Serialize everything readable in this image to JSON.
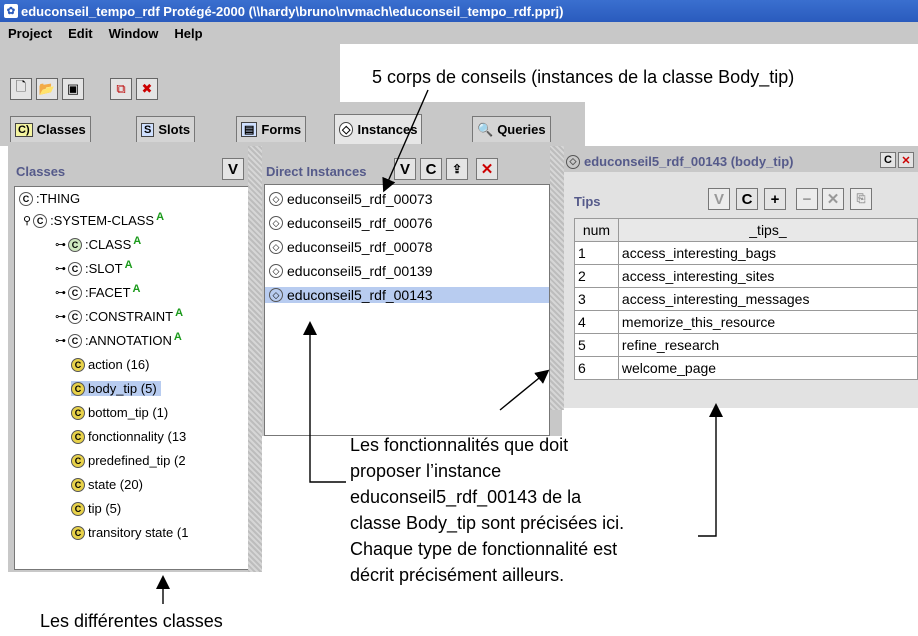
{
  "window": {
    "title": "educonseil_tempo_rdf  Protégé-2000   (\\\\hardy\\bruno\\nvmach\\educonseil_tempo_rdf.pprj)"
  },
  "menu": [
    "Project",
    "Edit",
    "Window",
    "Help"
  ],
  "toolbar_icons": [
    "new-project-icon",
    "open-project-icon",
    "save-project-icon",
    "cascade-icon",
    "close-icon"
  ],
  "tabs": [
    {
      "label": "Classes",
      "icon": "C"
    },
    {
      "label": "Slots",
      "icon": "S"
    },
    {
      "label": "Forms",
      "icon": "F"
    },
    {
      "label": "Instances",
      "icon": "I"
    },
    {
      "label": "Queries",
      "icon": "Q"
    }
  ],
  "classes_panel": {
    "header": "Classes",
    "v_button": "V",
    "tree": [
      {
        "label": ":THING",
        "marker": ""
      },
      {
        "label": ":SYSTEM-CLASS",
        "marker": "A"
      },
      {
        "label": ":CLASS",
        "marker": "A"
      },
      {
        "label": ":SLOT",
        "marker": "A"
      },
      {
        "label": ":FACET",
        "marker": "A"
      },
      {
        "label": ":CONSTRAINT",
        "marker": "A"
      },
      {
        "label": ":ANNOTATION",
        "marker": "A"
      },
      {
        "label": "action  (16)",
        "marker": ""
      },
      {
        "label": "body_tip  (5)",
        "marker": "",
        "selected": true
      },
      {
        "label": "bottom_tip  (1)",
        "marker": ""
      },
      {
        "label": "fonctionnality  (13",
        "marker": ""
      },
      {
        "label": "predefined_tip  (2",
        "marker": ""
      },
      {
        "label": "state  (20)",
        "marker": ""
      },
      {
        "label": "tip  (5)",
        "marker": ""
      },
      {
        "label": "transitory state  (1",
        "marker": ""
      }
    ]
  },
  "instances_panel": {
    "header": "Direct Instances",
    "buttons": [
      "V",
      "C"
    ],
    "items": [
      "educonseil5_rdf_00073",
      "educonseil5_rdf_00076",
      "educonseil5_rdf_00078",
      "educonseil5_rdf_00139",
      "educonseil5_rdf_00143"
    ],
    "selected_index": 4
  },
  "form_panel": {
    "header": "educonseil5_rdf_00143  (body_tip)",
    "header_button": "C",
    "tips_label": "Tips",
    "tips_buttons": [
      "V",
      "C",
      "+",
      "−"
    ],
    "columns": [
      "num",
      "_tips_"
    ],
    "rows": [
      [
        "1",
        "access_interesting_bags"
      ],
      [
        "2",
        "access_interesting_sites"
      ],
      [
        "3",
        "access_interesting_messages"
      ],
      [
        "4",
        "memorize_this_resource"
      ],
      [
        "5",
        "refine_research"
      ],
      [
        "6",
        "welcome_page"
      ]
    ]
  },
  "annotations": {
    "top": "5 corps de conseils (instances de la classe Body_tip)",
    "middle": [
      "Les fonctionnalités que doit",
      "proposer l’instance",
      "educonseil5_rdf_00143 de la",
      "classe Body_tip sont précisées ici.",
      "Chaque type de fonctionnalité est",
      "décrit précisément ailleurs."
    ],
    "bottom": "Les différentes classes"
  }
}
